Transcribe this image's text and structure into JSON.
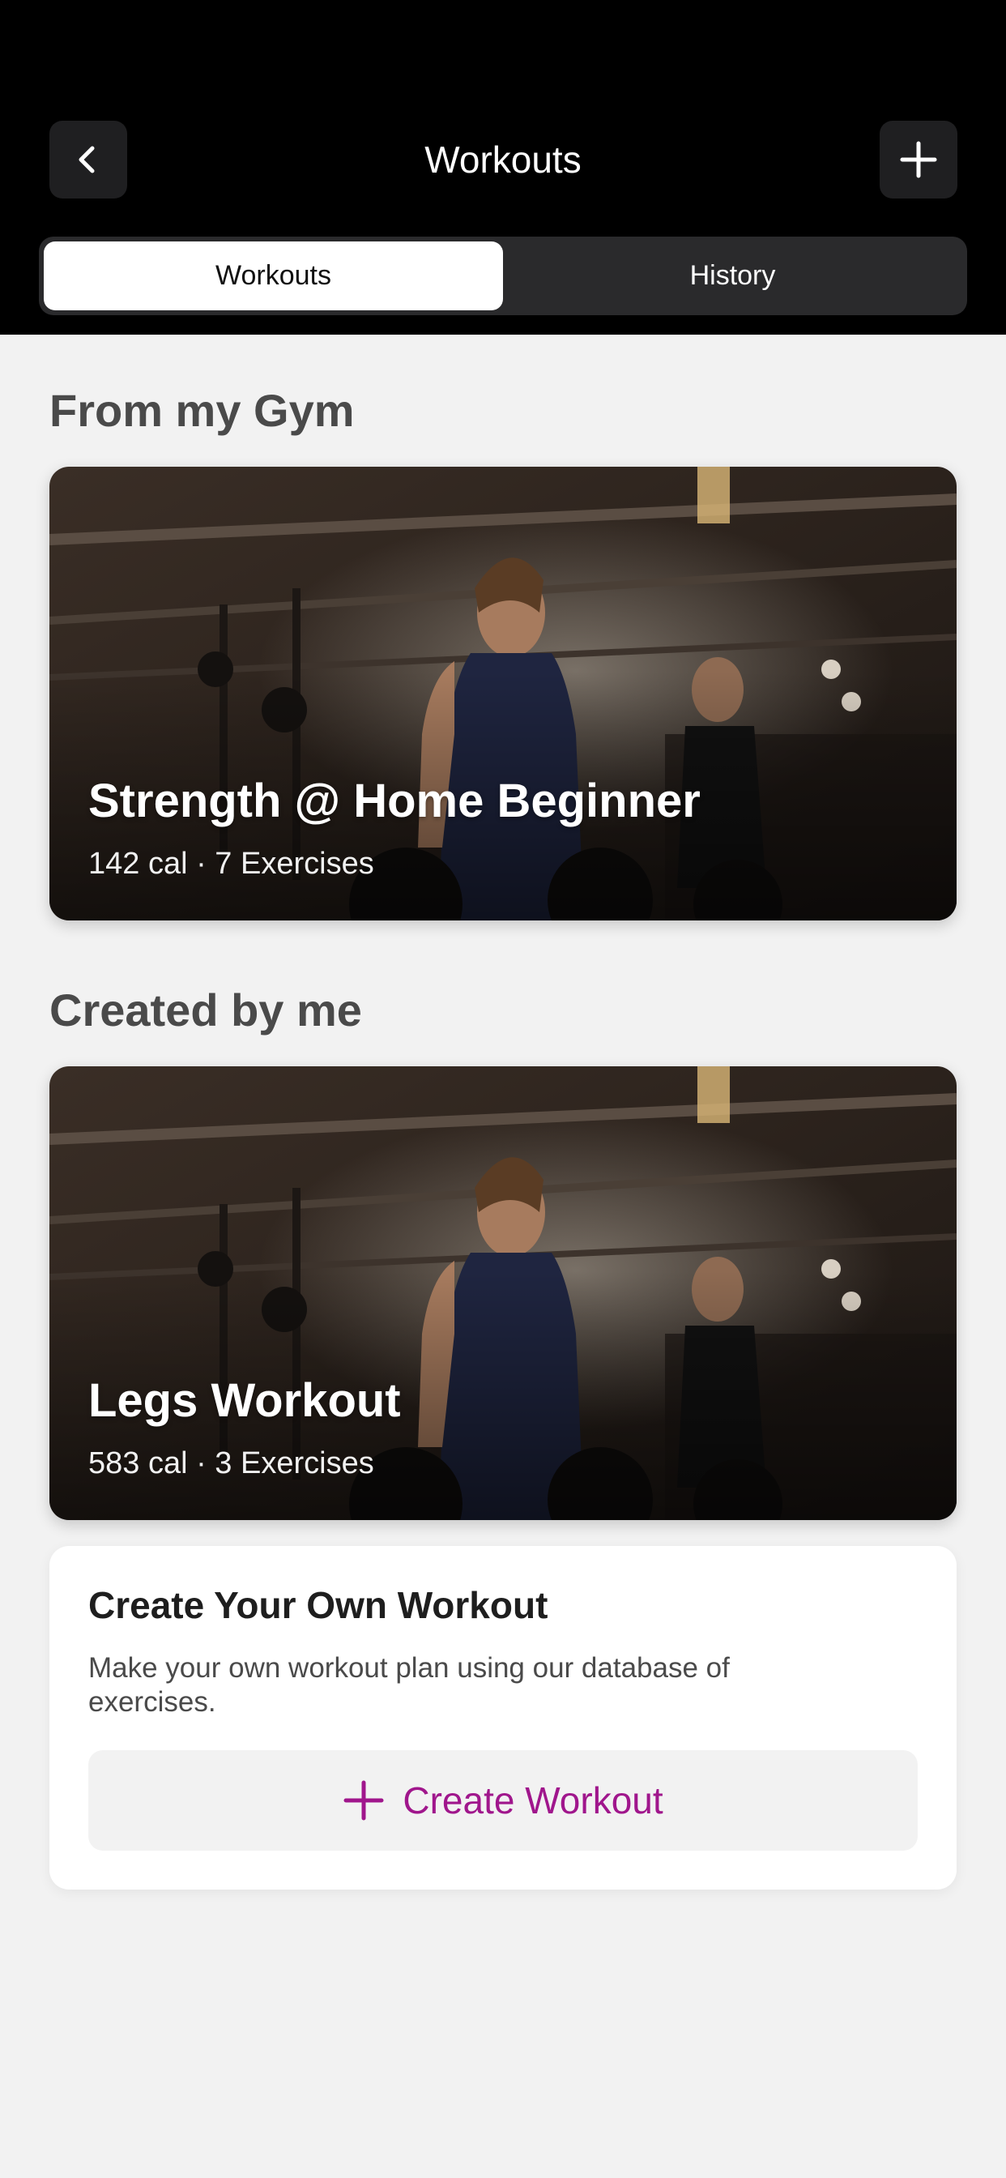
{
  "header": {
    "title": "Workouts",
    "back_icon": "chevron-left-icon",
    "add_icon": "plus-icon"
  },
  "tabs": [
    {
      "label": "Workouts",
      "active": true
    },
    {
      "label": "History",
      "active": false
    }
  ],
  "sections": {
    "gym_title": "From my Gym",
    "mine_title": "Created by me"
  },
  "workouts": {
    "gym": {
      "name": "Strength @ Home Beginner",
      "meta": "142 cal · 7 Exercises"
    },
    "mine": {
      "name": "Legs Workout",
      "meta": "583 cal · 3 Exercises"
    }
  },
  "create": {
    "title": "Create Your Own Workout",
    "description": "Make your own workout plan using our database of exercises.",
    "button_label": "Create Workout",
    "button_icon": "plus-icon"
  },
  "colors": {
    "accent": "#a0168c",
    "header_bg": "#000000",
    "page_bg": "#f2f2f2"
  }
}
